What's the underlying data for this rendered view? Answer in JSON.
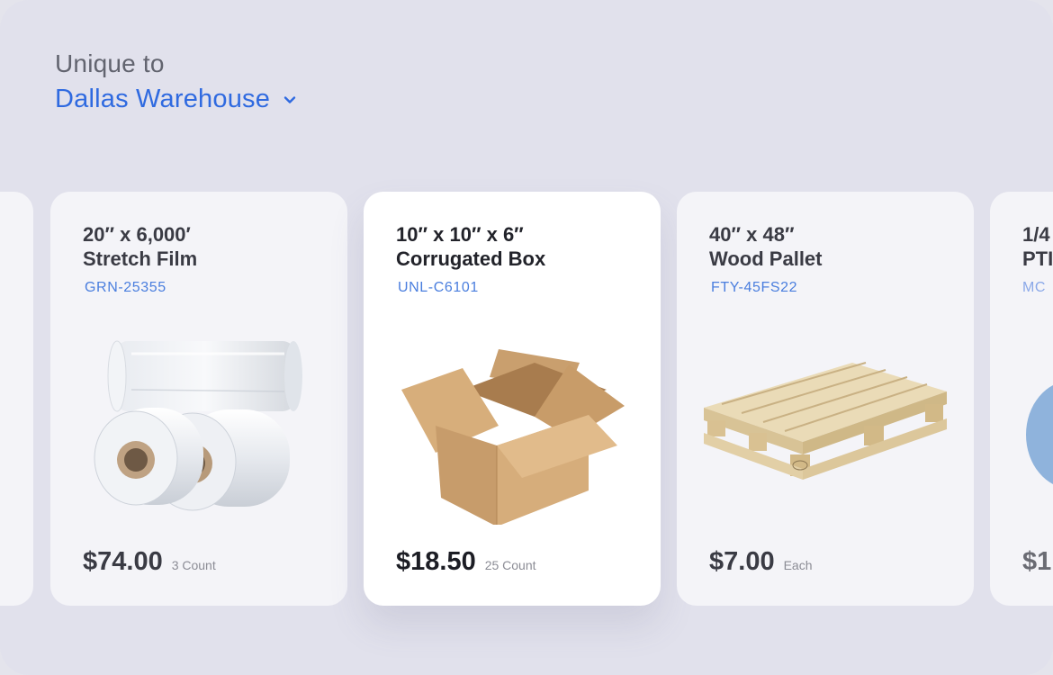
{
  "header": {
    "kicker": "Unique to",
    "location": "Dallas Warehouse"
  },
  "products": [
    {
      "title_line1": "20″ x 6,000′",
      "title_line2": "Stretch Film",
      "sku": "GRN-25355",
      "price": "$74.00",
      "unit": "3 Count",
      "icon": "stretch-film-image"
    },
    {
      "title_line1": "10″ x 10″ x 6″",
      "title_line2": "Corrugated Box",
      "sku": "UNL-C6101",
      "price": "$18.50",
      "unit": "25 Count",
      "icon": "cardboard-box-image"
    },
    {
      "title_line1": "40″ x 48″",
      "title_line2": "Wood Pallet",
      "sku": "FTY-45FS22",
      "price": "$7.00",
      "unit": "Each",
      "icon": "wood-pallet-image"
    }
  ],
  "partial_card": {
    "title_line1": "1/4",
    "title_line2": "PTI",
    "sku": "MC",
    "price": "$1"
  },
  "colors": {
    "accent": "#2f6ae0",
    "sku": "#4a7ede",
    "background": "#e1e1ec"
  }
}
